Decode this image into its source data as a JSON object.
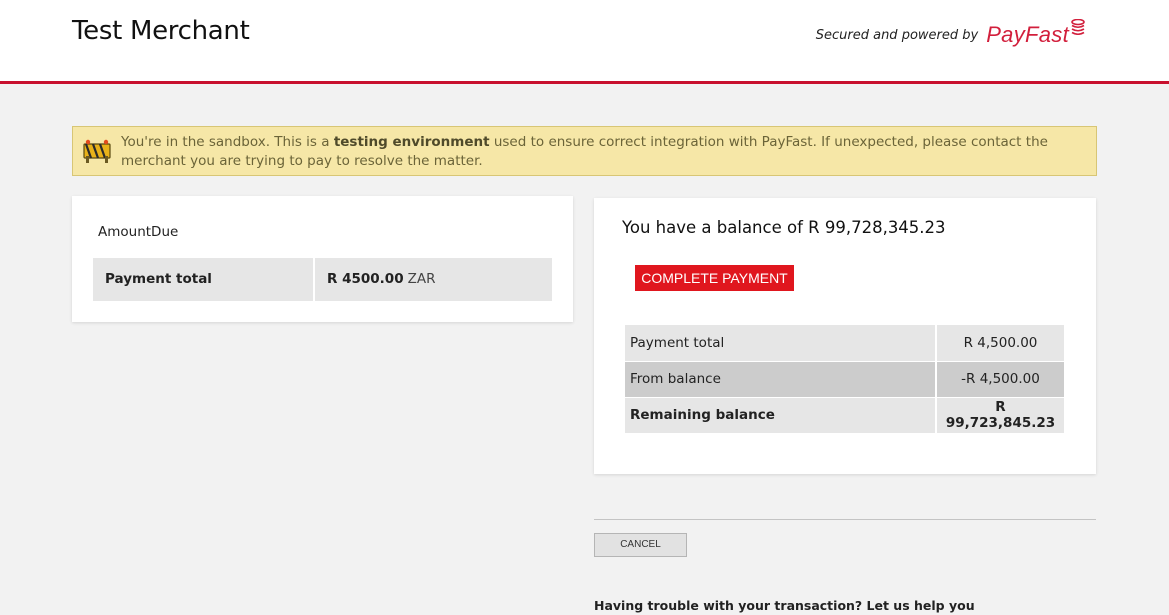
{
  "header": {
    "merchant_name": "Test Merchant",
    "powered_by": "Secured and powered by",
    "brand": "PayFast",
    "brand_color": "#d21f3c"
  },
  "notice": {
    "icon": "sandbox-warning-icon",
    "text_before": "You're in the sandbox. This is a ",
    "text_bold": "testing environment",
    "text_after": " used to ensure correct integration with PayFast. If unexpected, please contact the merchant you are trying to pay to resolve the matter."
  },
  "order": {
    "item_name": "AmountDue",
    "total_label": "Payment total",
    "total_amount": "R 4500.00",
    "currency": "ZAR"
  },
  "wallet": {
    "balance_heading": "You have a balance of R 99,728,345.23",
    "complete_label": "COMPLETE PAYMENT",
    "accent_color": "#e0161e",
    "rows": [
      {
        "label": "Payment total",
        "amount": "R 4,500.00"
      },
      {
        "label": "From balance",
        "amount": "-R 4,500.00"
      },
      {
        "label": "Remaining balance",
        "amount": "R 99,723,845.23"
      }
    ]
  },
  "footer": {
    "cancel_label": "CANCEL",
    "help_text": "Having trouble with your transaction? Let us help you"
  }
}
